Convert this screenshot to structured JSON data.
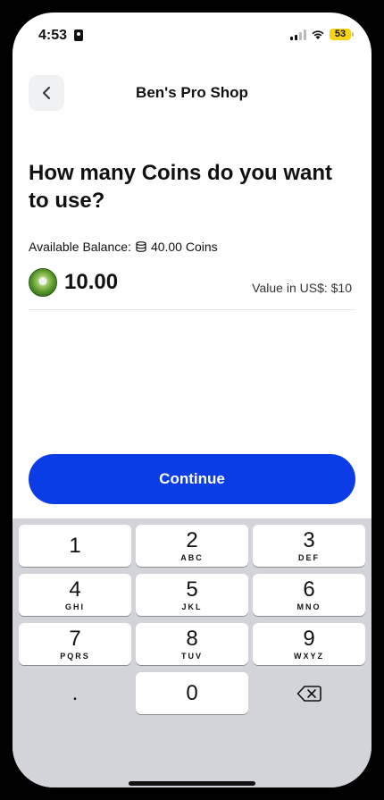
{
  "status_bar": {
    "time": "4:53",
    "battery": "53",
    "battery_color": "#f5d312"
  },
  "header": {
    "back_icon": "chevron-left-icon",
    "title": "Ben's Pro Shop"
  },
  "question": "How many Coins do you want to use?",
  "balance": {
    "label": "Available Balance:",
    "icon": "coins-stack-icon",
    "value": "40.00 Coins"
  },
  "amount": {
    "value": "10.00",
    "usd_label": "Value in US$: $10"
  },
  "continue_label": "Continue",
  "accent_color": "#0a3de6",
  "keypad": [
    {
      "num": "1",
      "letters": ""
    },
    {
      "num": "2",
      "letters": "ABC"
    },
    {
      "num": "3",
      "letters": "DEF"
    },
    {
      "num": "4",
      "letters": "GHI"
    },
    {
      "num": "5",
      "letters": "JKL"
    },
    {
      "num": "6",
      "letters": "MNO"
    },
    {
      "num": "7",
      "letters": "PQRS"
    },
    {
      "num": "8",
      "letters": "TUV"
    },
    {
      "num": "9",
      "letters": "WXYZ"
    },
    {
      "num": ".",
      "letters": ""
    },
    {
      "num": "0",
      "letters": ""
    },
    {
      "num": "",
      "letters": "",
      "icon": "backspace-icon"
    }
  ]
}
